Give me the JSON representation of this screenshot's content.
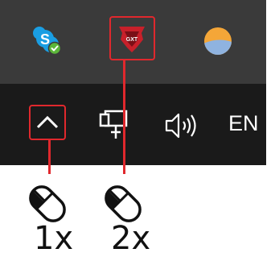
{
  "tray_overflow": {
    "icons": [
      {
        "name": "skype-icon",
        "glyph": "S"
      },
      {
        "name": "gaming-mouse-software-icon",
        "badge": "GXT"
      },
      {
        "name": "weather-icon"
      }
    ]
  },
  "taskbar": {
    "icons": [
      {
        "name": "show-hidden-icons-chevron-icon"
      },
      {
        "name": "network-icon"
      },
      {
        "name": "volume-icon"
      }
    ],
    "language": "EN"
  },
  "instructions": [
    {
      "target": "show-hidden-icons-chevron-icon",
      "label": "1x"
    },
    {
      "target": "gaming-mouse-software-icon",
      "label": "2x"
    }
  ],
  "colors": {
    "highlight": "#e0282d",
    "taskbar": "#1a1a1a",
    "overflow_panel": "#3a3a3a",
    "skype_blue": "#1a9ee3"
  }
}
